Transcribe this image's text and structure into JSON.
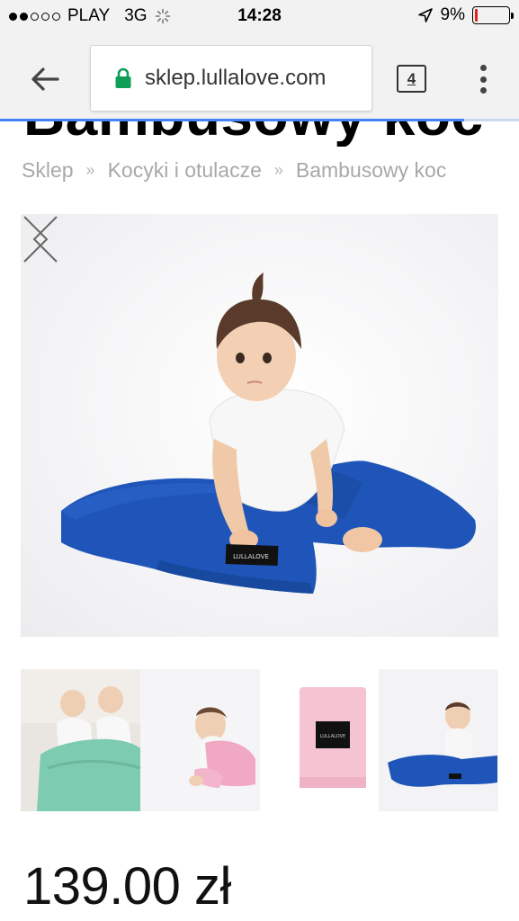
{
  "status_bar": {
    "carrier": "PLAY",
    "network": "3G",
    "time": "14:28",
    "battery": "9%",
    "battery_level": 0.09,
    "signal_bars_filled": 2,
    "signal_bars_total": 5
  },
  "browser": {
    "url": "sklep.lullalove.com",
    "tab_count": "4",
    "icons": {
      "back": "arrow-left-icon",
      "lock": "lock-icon",
      "menu": "vertical-dots-icon"
    },
    "accent_color": "#4285f4",
    "lock_color": "#0f9d58"
  },
  "page": {
    "title": "Bambusowy koc",
    "breadcrumb": {
      "items": [
        "Sklep",
        "Kocyki i otulacze",
        "Bambusowy koc"
      ],
      "separator": "»"
    },
    "gallery": {
      "prev_icon": "chevron-left-icon",
      "next_icon": "chevron-right-icon",
      "thumbnails": [
        "thumb-twins-mint-blanket",
        "thumb-baby-pink-blanket",
        "thumb-pink-blanket-folded",
        "thumb-baby-blue-blanket"
      ]
    },
    "price": "139.00 zł"
  }
}
